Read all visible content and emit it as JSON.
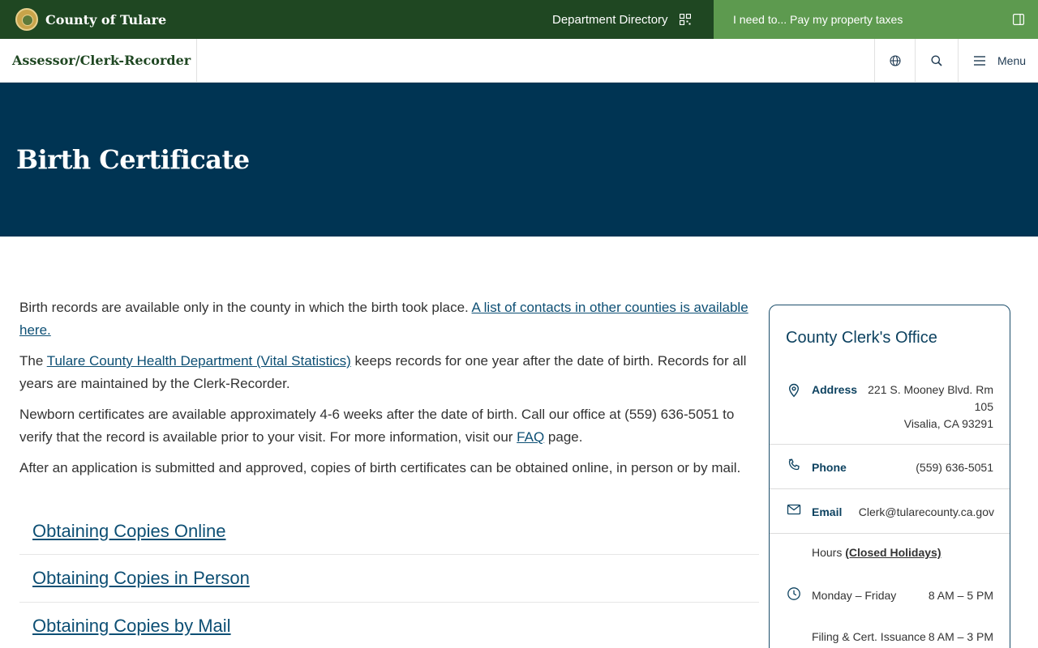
{
  "topbar": {
    "county_name": "County of Tulare",
    "dept_directory": "Department Directory",
    "ineed": "I need to... Pay my property taxes",
    "colors": {
      "bar": "#1f4722",
      "ineed_bg": "#5d9a4f"
    }
  },
  "subheader": {
    "dept_name": "Assessor/Clerk-Recorder",
    "menu_label": "Menu",
    "icons": [
      "globe-icon",
      "search-icon",
      "hamburger-icon"
    ]
  },
  "hero": {
    "title": "Birth Certificate",
    "bg_color": "#003453"
  },
  "content": {
    "p1_text": "Birth records are available only in the county in which the birth took place. ",
    "p1_link": "A list of contacts in other counties is available here.",
    "p2_pre": "The ",
    "p2_link": "Tulare County Health Department (Vital Statistics)",
    "p2_post": " keeps records for one year after the date of birth. Records for all years are maintained by the Clerk-Recorder.",
    "p3_pre": "Newborn certificates are available approximately 4-6 weeks after the date of birth. Call our office at (559) 636-5051 to verify that the record is available prior to your visit. For more information, visit our ",
    "p3_link": "FAQ",
    "p3_post": " page.",
    "p4_text": "After an application is submitted and approved, copies of birth certificates can be obtained online, in person or by mail."
  },
  "accordion": [
    {
      "label": "Obtaining Copies Online"
    },
    {
      "label": "Obtaining Copies in Person"
    },
    {
      "label": "Obtaining Copies by Mail"
    }
  ],
  "card": {
    "title": "County Clerk's Office",
    "address_label": "Address",
    "address_line1": "221 S. Mooney Blvd. Rm",
    "address_line2": "105",
    "address_line3": "Visalia, CA 93291",
    "phone_label": "Phone",
    "phone_value": "(559) 636-5051",
    "email_label": "Email",
    "email_value": "Clerk@tularecounty.ca.gov",
    "hours_label": "Hours",
    "hours_link": "(Closed Holidays)",
    "hours": [
      {
        "label": "Monday – Friday",
        "value": "8 AM – 5 PM"
      },
      {
        "label": "Filing & Cert. Issuance",
        "value": "8 AM – 3 PM"
      }
    ]
  }
}
